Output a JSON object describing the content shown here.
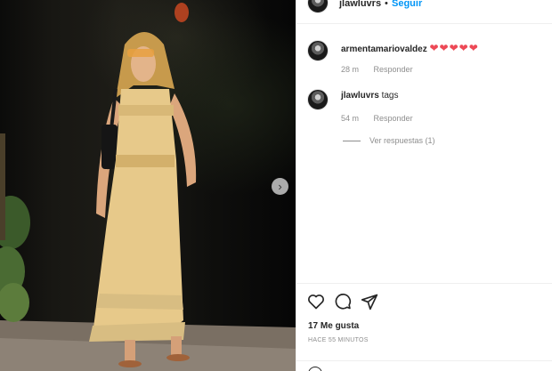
{
  "post": {
    "username": "jlawluvrs",
    "separator": "•",
    "follow_label": "Seguir"
  },
  "comments": [
    {
      "username": "armentamariovaldez",
      "text": "❤❤❤❤❤",
      "time": "28 m",
      "reply_label": "Responder"
    },
    {
      "username": "jlawluvrs",
      "text": "tags",
      "time": "54 m",
      "reply_label": "Responder"
    }
  ],
  "view_replies_label": "Ver respuestas (1)",
  "actions": {
    "icons": [
      "heart-icon",
      "comment-icon",
      "share-icon"
    ],
    "likes": "17 Me gusta",
    "posted": "HACE 55 MINUTOS"
  },
  "colors": {
    "follow": "#0095f6",
    "heart": "#ed4956",
    "muted": "#8e8e8e"
  }
}
